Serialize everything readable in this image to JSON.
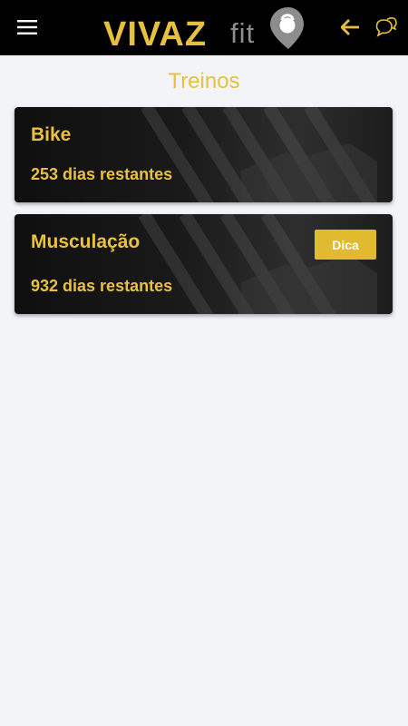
{
  "header": {
    "brand_main": "VIVAZ",
    "brand_sub": "fit",
    "menu_icon": "hamburger-menu-icon",
    "back_icon": "arrow-left-icon",
    "chat_icon": "chat-bubbles-icon",
    "accent_color": "#e7c040"
  },
  "page": {
    "title": "Treinos"
  },
  "workouts": [
    {
      "name": "Bike",
      "days_left": "253 dias restantes"
    },
    {
      "name": "Musculação",
      "days_left": "932 dias restantes",
      "tip_label": "Dica"
    }
  ]
}
